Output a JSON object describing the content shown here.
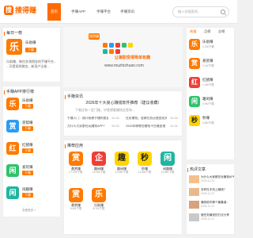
{
  "header": {
    "logo_text": "搜得赚",
    "logo_mark": "搜",
    "nav": [
      {
        "label": "首页",
        "active": true
      },
      {
        "label": "手赚APP",
        "active": false
      },
      {
        "label": "手赚平台",
        "active": false
      },
      {
        "label": "手赚资讯",
        "active": false
      }
    ],
    "search_placeholder": "输入你搜索的..."
  },
  "daily": {
    "title": "每日一荐",
    "app_name": "乐助赚",
    "icon_glyph": "乐",
    "download_label": "下载",
    "desc": "乐助赚，做任务领佣金的手赚平台...",
    "desc2": "...可提现到微信，新用户注册..."
  },
  "banner": {
    "logo": "搜得赚",
    "slogan": "让兼职变得简单有趣",
    "url": "www.muzhizhuan.com"
  },
  "rank": {
    "title": "手赚APP排行榜",
    "items": [
      {
        "name": "乐助赚",
        "glyph": "乐",
        "color": "orange",
        "dl": "下载"
      },
      {
        "name": "赏帮赚",
        "glyph": "赏",
        "color": "blue",
        "dl": "下载"
      },
      {
        "name": "红猪赚",
        "glyph": "红",
        "color": "orange",
        "dl": "下载"
      },
      {
        "name": "爱玩赚",
        "glyph": "闲",
        "color": "green",
        "dl": "下载"
      },
      {
        "name": "闲趣赚",
        "glyph": "闲",
        "color": "teal",
        "dl": "下载"
      }
    ],
    "more": "查看更多 >"
  },
  "news": {
    "title": "手赚资讯",
    "headline": "2026年十大良心赚钱软件推荐（建议收藏）",
    "summary": "下载还有一定门槛，毕竟想要赚钱总是有...",
    "items": [
      {
        "text": "手赚入门：刚开始做手赚的朋友一定要看",
        "date": "12-02"
      },
      {
        "text": "在家赚钱，靠做任务还能提现到微信",
        "date": "12-02"
      },
      {
        "text": "为什么大家都在玩赚钱APP？",
        "date": "12-02"
      },
      {
        "text": "2026年做哪些赚钱平台最靠谱",
        "date": "12-01"
      }
    ]
  },
  "recommend": {
    "title": "推荐应用",
    "apps": [
      {
        "name": "悬赏赚",
        "glyph": "赏",
        "color": "orange",
        "meta": "17.2M下载",
        "dl": "下载"
      },
      {
        "name": "趣闲赚",
        "glyph": "企",
        "color": "red",
        "meta": "14.3M下载",
        "dl": "下载"
      },
      {
        "name": "趣闲赚",
        "glyph": "趣",
        "color": "yellow",
        "meta": "12.5M下载",
        "dl": "下载"
      },
      {
        "name": "秒赚",
        "glyph": "秒",
        "color": "yellow",
        "meta": "11.6M下载",
        "dl": "下载"
      },
      {
        "name": "闲趣赚",
        "glyph": "闲",
        "color": "teal",
        "meta": "10.8M下载",
        "dl": "下载"
      },
      {
        "name": "悬赏赚",
        "glyph": "赏",
        "color": "orange",
        "meta": "9.6M下载",
        "dl": "下载"
      },
      {
        "name": "乐助赚",
        "glyph": "乐",
        "color": "orange",
        "meta": "8.7M下载",
        "dl": "下载"
      }
    ]
  },
  "hot": {
    "tabs": [
      {
        "label": "热搜",
        "active": true
      },
      {
        "label": "月榜",
        "active": false
      },
      {
        "label": "总榜",
        "active": false
      }
    ],
    "items": [
      {
        "name": "乐助赚",
        "glyph": "乐",
        "color": "orange",
        "meta": "1.2M下载"
      },
      {
        "name": "悬赏赚",
        "glyph": "赏",
        "color": "orange",
        "meta": "1.1M下载"
      },
      {
        "name": "红猪赚",
        "glyph": "红",
        "color": "red",
        "meta": "1.0M下载"
      },
      {
        "name": "趣闲赚",
        "glyph": "闲",
        "color": "green",
        "meta": "0.9M下载"
      },
      {
        "name": "秒赚",
        "glyph": "秒",
        "color": "yellow",
        "meta": "0.8M下载"
      }
    ]
  },
  "articles": {
    "title": "热评文章",
    "items": [
      {
        "title": "为什么大家都在玩赚钱APP...",
        "date": "2025-11-22"
      },
      {
        "title": "怎样在手机上赚钱？",
        "date": "2025-11-22"
      },
      {
        "title": "赚钱软件哪个最靠谱...",
        "date": "2025-11-22"
      },
      {
        "title": "做任务赚钱的方法分享",
        "date": "2025-11-21"
      }
    ]
  },
  "colors": {
    "accent": "#ff6a00"
  }
}
